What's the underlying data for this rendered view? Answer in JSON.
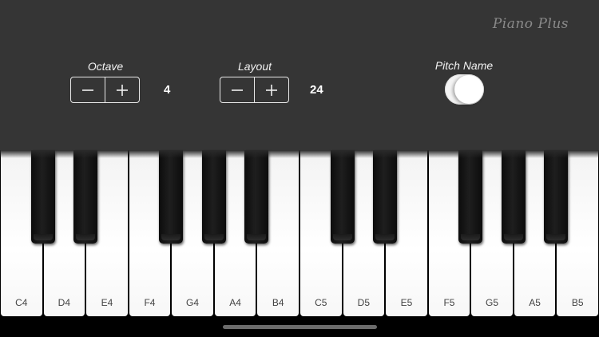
{
  "brand": "Piano Plus",
  "controls": {
    "octave": {
      "label": "Octave",
      "value": "4",
      "minus": "minus-icon",
      "plus": "plus-icon"
    },
    "layout": {
      "label": "Layout",
      "value": "24",
      "minus": "minus-icon",
      "plus": "plus-icon"
    },
    "pitch_name": {
      "label": "Pitch Name",
      "enabled": true
    }
  },
  "keyboard": {
    "white_keys": [
      "C4",
      "D4",
      "E4",
      "F4",
      "G4",
      "A4",
      "B4",
      "C5",
      "D5",
      "E5",
      "F5",
      "G5",
      "A5",
      "B5"
    ],
    "black_keys": [
      "C#4",
      "D#4",
      "F#4",
      "G#4",
      "A#4",
      "C#5",
      "D#5",
      "F#5",
      "G#5",
      "A#5"
    ]
  }
}
